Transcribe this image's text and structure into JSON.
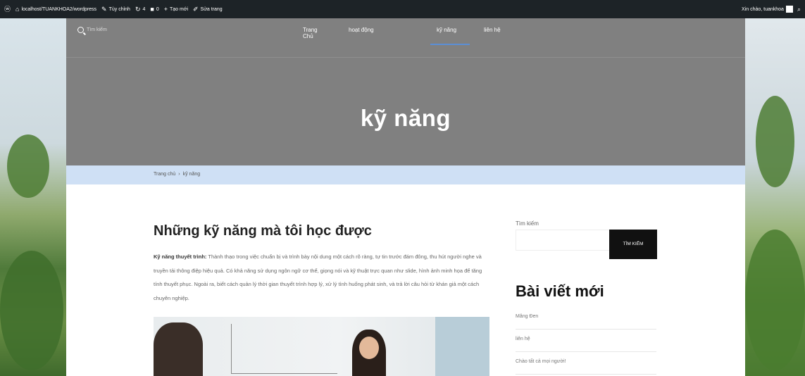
{
  "adminbar": {
    "site_url": "localhost/TUANKHOA2/wordpress",
    "customize": "Tùy chỉnh",
    "updates_count": "4",
    "comments_count": "0",
    "new_label": "Tạo mới",
    "edit_label": "Sửa trang",
    "greeting": "Xin chào, tuankhoa"
  },
  "header": {
    "search_placeholder": "Tìm kiếm",
    "nav": [
      "Trang Chủ",
      "hoạt động",
      "kỹ năng",
      "liên hệ"
    ],
    "active_nav": "kỹ năng",
    "page_title": "kỹ năng"
  },
  "breadcrumb": {
    "home": "Trang chủ",
    "separator": "›",
    "current": "kỹ năng"
  },
  "post": {
    "title": "Những kỹ năng mà tôi học được",
    "lead_bold": "Kỹ năng thuyết trình:",
    "body": "Thành thạo trong việc chuẩn bị và trình bày nội dung một cách rõ ràng, tự tin trước đám đông, thu hút người nghe và truyền tải thông điệp hiệu quả. Có khả năng sử dụng ngôn ngữ cơ thể, giọng nói và kỹ thuật trực quan như slide, hình ảnh minh họa để tăng tính thuyết phục. Ngoài ra, biết cách quản lý thời gian thuyết trình hợp lý, xử lý tình huống phát sinh, và trả lời câu hỏi từ khán giả một cách chuyên nghiệp."
  },
  "sidebar": {
    "search_label": "Tìm kiếm",
    "search_button": "TÌM KIẾM",
    "recent_heading": "Bài viết mới",
    "recent_posts": [
      "Măng Đen",
      "liên hệ",
      "Chào tất cả mọi người!"
    ]
  },
  "colors": {
    "header_bg": "#808080",
    "breadcrumb_bg": "#cfe0f5",
    "nav_active_underline": "#5b8fd6",
    "adminbar_bg": "#1d2327"
  }
}
